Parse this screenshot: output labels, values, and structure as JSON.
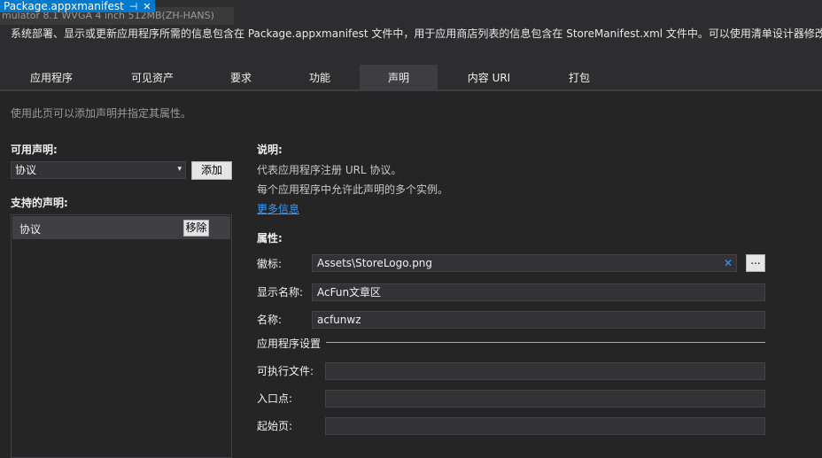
{
  "document_tab": {
    "title": "Package.appxmanifest",
    "pin_glyph": "⊣",
    "close_glyph": "✕"
  },
  "emulator_strip": "mulator 8.1 WVGA 4 inch 512MB(ZH-HANS)",
  "description": "系统部署、显示或更新应用程序所需的信息包含在 Package.appxmanifest 文件中，用于应用商店列表的信息包含在 StoreManifest.xml 文件中。可以使用清单设计器修改这",
  "tabs": [
    {
      "label": "应用程序",
      "active": false
    },
    {
      "label": "可见资产",
      "active": false
    },
    {
      "label": "要求",
      "active": false
    },
    {
      "label": "功能",
      "active": false
    },
    {
      "label": "声明",
      "active": true
    },
    {
      "label": "内容 URI",
      "active": false
    },
    {
      "label": "打包",
      "active": false
    }
  ],
  "page_hint": "使用此页可以添加声明并指定其属性。",
  "left": {
    "available_label": "可用声明:",
    "available_value": "协议",
    "add_label": "添加",
    "supported_label": "支持的声明:",
    "supported_item": "协议",
    "remove_label": "移除"
  },
  "right": {
    "desc_label": "说明:",
    "desc_line1": "代表应用程序注册 URL 协议。",
    "desc_line2": "每个应用程序中允许此声明的多个实例。",
    "more_info": "更多信息",
    "props_label": "属性:",
    "logo_label": "徽标:",
    "logo_value": "Assets\\StoreLogo.png",
    "logo_clear_glyph": "✕",
    "browse_label": "...",
    "display_name_label": "显示名称:",
    "display_name_value": "AcFun文章区",
    "name_label": "名称:",
    "name_value": "acfunwz",
    "app_settings_label": "应用程序设置",
    "executable_label": "可执行文件:",
    "executable_value": "",
    "entry_point_label": "入口点:",
    "entry_point_value": "",
    "start_page_label": "起始页:",
    "start_page_value": ""
  },
  "colors": {
    "accent": "#007acc",
    "link": "#3399ff",
    "background": "#2d2d30",
    "content": "#252526"
  }
}
